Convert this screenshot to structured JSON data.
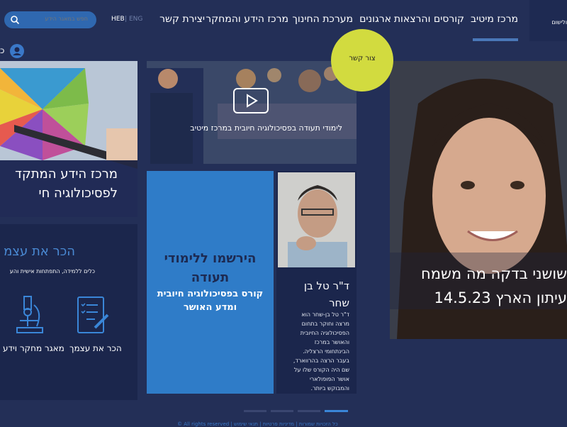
{
  "nav": {
    "items": [
      "מרכז מיטיב",
      "קורסים והרצאות",
      "ארגונים",
      "מערכת החינוך",
      "מרכז הידע והמחקר",
      "יצירת קשר"
    ],
    "lang_heb": "HEB",
    "lang_eng": "ENG",
    "right_edge": "ולישום"
  },
  "search": {
    "placeholder": "חפש במאגר הידע"
  },
  "user": {
    "letter": "כ"
  },
  "chart_card": {
    "title_line1": "מרכז הידע המתקד",
    "title_line2": "לפסיכולוגיה חי"
  },
  "know_card": {
    "title": "הכר את עצמ",
    "subtitle": "כלים ללמידה, התפתחות אישית והע",
    "item1": "הכר את עצמך",
    "item2": "מאגר מחקר וידע"
  },
  "video_card": {
    "caption": "לימודי תעודה בפסיכולוגיה חיובית במרכז מיטיב"
  },
  "register_card": {
    "title_line1": "הירשמו ללימודי",
    "title_line2": "תעודה",
    "sub_line1": "קורס בפסיכולוגיה חיובית",
    "sub_line2": "ומדע האושר"
  },
  "person_card": {
    "name_line1": "ד\"ר טל בן",
    "name_line2": "שחר",
    "bio_lines": [
      "ד\"ר טל בן-שחר הוא",
      "מרצה וחוקר בתחום",
      "הפסיכולוגיה החיובית",
      "והאושר במרכז",
      "הבינתחומי הרצליה.",
      "בעבר הרצה בהרווארד,",
      "שם היה הקורס שלו על",
      "אושר הפופולארי",
      "והמבוקש ביותר."
    ]
  },
  "hero": {
    "line1": "שושני בדקה מה משמח",
    "line2": "עיתון הארץ 14.5.23"
  },
  "contact": {
    "label": "צור קשר"
  },
  "footer": {
    "text": "© All rights reserved | כל הזכויות שמורות | מדיניות פרטיות | תנאי שימוש"
  },
  "colors": {
    "background": "#232f57",
    "accent_blue": "#2f7cc8",
    "badge_yellow": "#d2db3f"
  }
}
